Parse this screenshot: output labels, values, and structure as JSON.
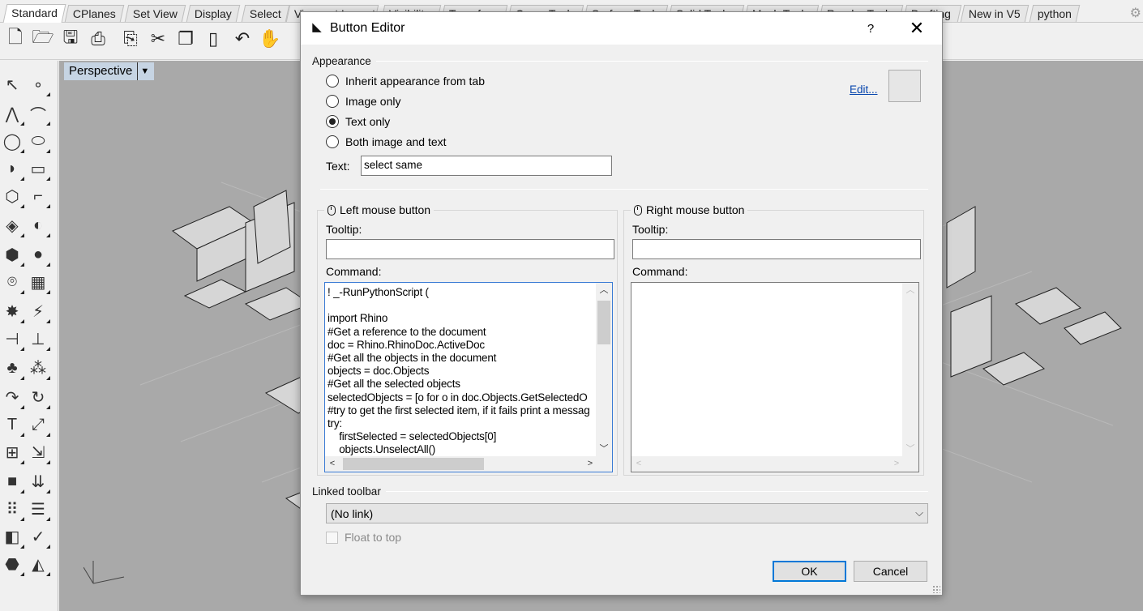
{
  "tabs": [
    "Standard",
    "CPlanes",
    "Set View",
    "Display",
    "Select",
    "Viewport Layout",
    "Visibility",
    "Transform",
    "Curve Tools",
    "Surface Tools",
    "Solid Tools",
    "Mesh Tools",
    "Render Tools",
    "Drafting",
    "New in V5",
    "python"
  ],
  "viewport": {
    "title": "Perspective",
    "axes": "x y z"
  },
  "dialog": {
    "title": "Button Editor",
    "help": "?",
    "close": "✕",
    "appearance": {
      "label": "Appearance",
      "options": [
        "Inherit appearance from tab",
        "Image only",
        "Text only",
        "Both image and text"
      ],
      "selected": "Text only",
      "edit_link": "Edit...",
      "text_label": "Text:",
      "text_value": "select same"
    },
    "left_mouse": {
      "label": "Left mouse button",
      "tooltip_label": "Tooltip:",
      "tooltip_value": "",
      "command_label": "Command:",
      "command_text": "! _-RunPythonScript (\n\nimport Rhino\n#Get a reference to the document\ndoc = Rhino.RhinoDoc.ActiveDoc\n#Get all the objects in the document\nobjects = doc.Objects\n#Get all the selected objects\nselectedObjects = [o for o in doc.Objects.GetSelectedO\n#try to get the first selected item, if it fails print a messag\ntry:\n    firstSelected = selectedObjects[0]\n    objects.UnselectAll()"
    },
    "right_mouse": {
      "label": "Right mouse button",
      "tooltip_label": "Tooltip:",
      "tooltip_value": "",
      "command_label": "Command:",
      "command_text": ""
    },
    "linked_toolbar": {
      "label": "Linked toolbar",
      "selected": "(No link)",
      "float_label": "Float to top"
    },
    "ok_label": "OK",
    "cancel_label": "Cancel"
  }
}
